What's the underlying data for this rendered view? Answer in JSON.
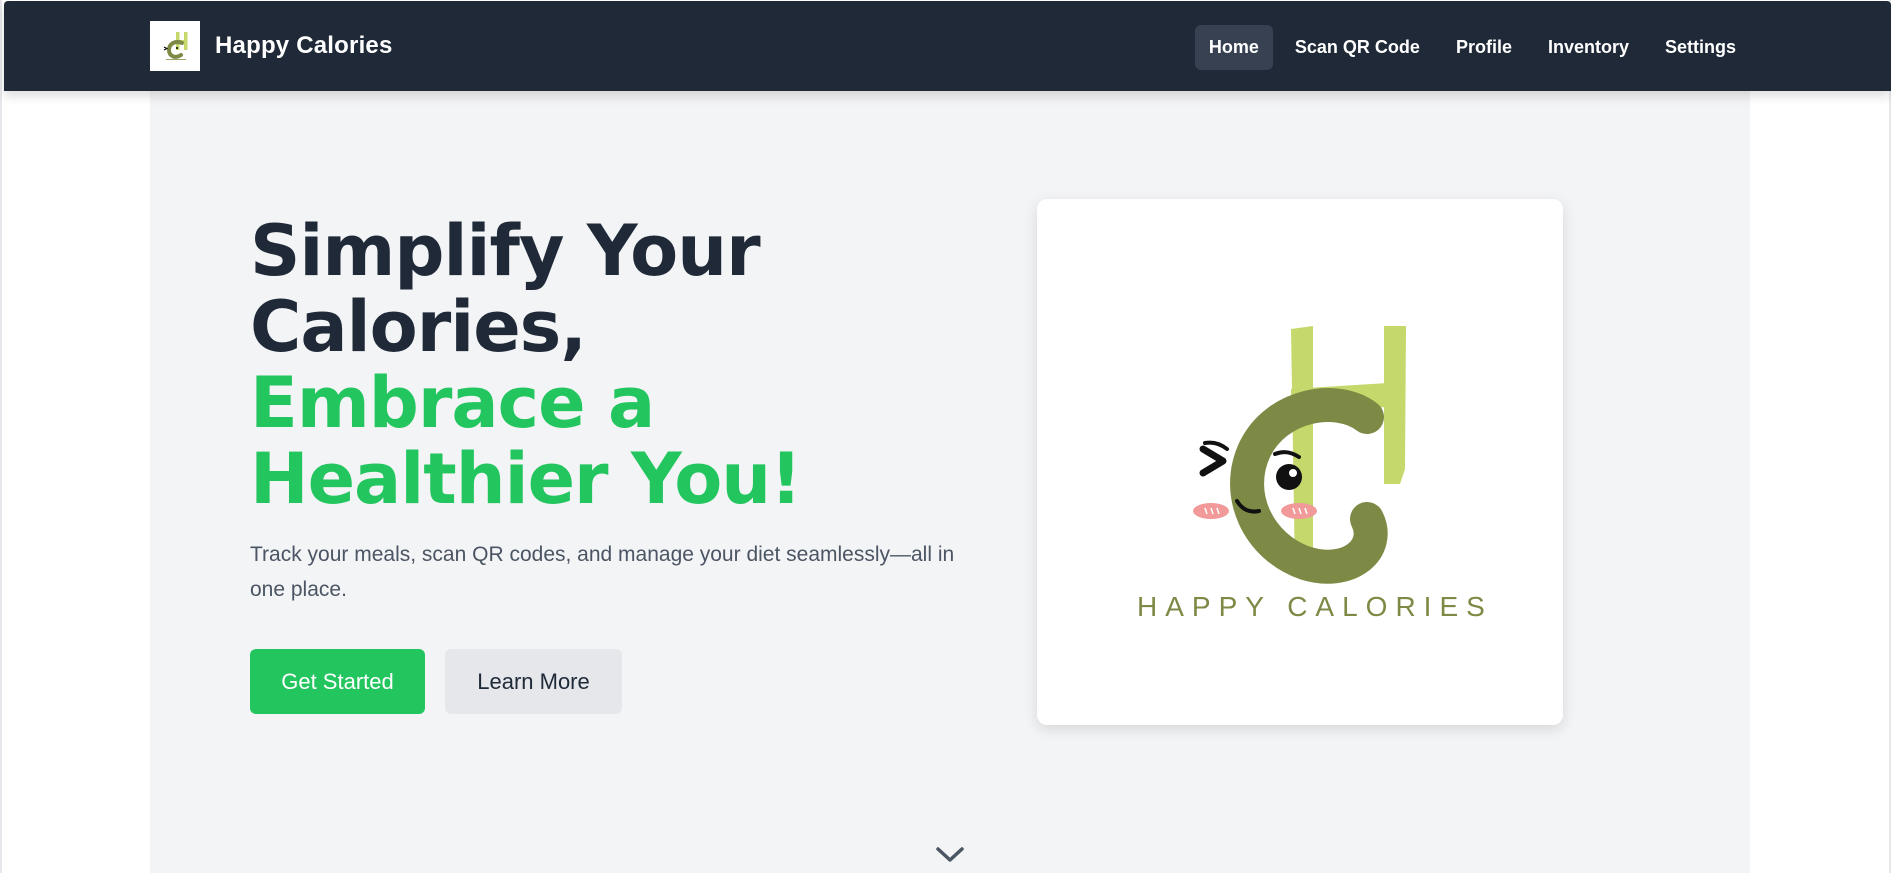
{
  "brand": {
    "name": "Happy Calories",
    "logo_icon": "happy-calories-logo"
  },
  "nav": {
    "items": [
      {
        "label": "Home",
        "active": true
      },
      {
        "label": "Scan QR Code",
        "active": false
      },
      {
        "label": "Profile",
        "active": false
      },
      {
        "label": "Inventory",
        "active": false
      },
      {
        "label": "Settings",
        "active": false
      }
    ]
  },
  "hero": {
    "headline_line1": "Simplify Your Calories,",
    "headline_line2": "Embrace a Healthier You!",
    "subtitle": "Track your meals, scan QR codes, and manage your diet seamlessly—all in one place.",
    "primary_button": "Get Started",
    "secondary_button": "Learn More",
    "logo_caption": "HAPPY CALORIES",
    "scroll_icon": "chevron-down-icon"
  },
  "colors": {
    "navbar_bg": "#1f2937",
    "nav_active_bg": "#374151",
    "hero_bg": "#f3f4f6",
    "accent_green": "#22c55e",
    "heading_dark": "#1f2937",
    "logo_olive": "#7d8a45",
    "logo_lime": "#c4d86b"
  }
}
